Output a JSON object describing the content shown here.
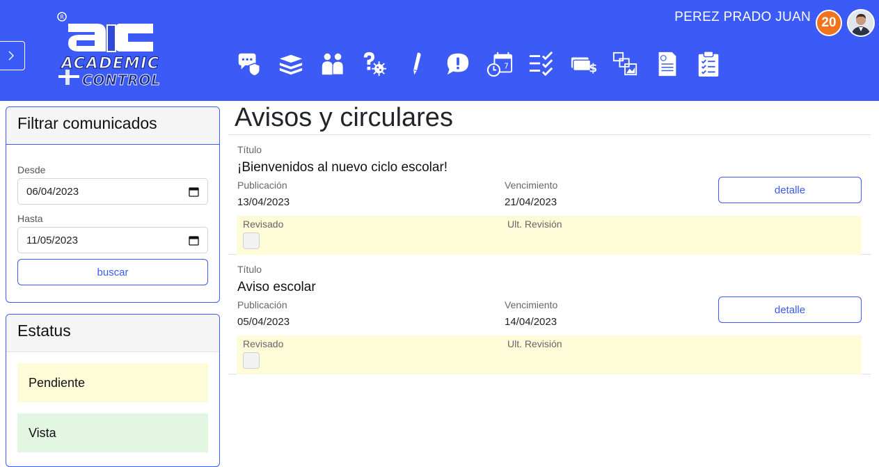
{
  "header": {
    "logo_text_top": "ACADEMIC",
    "logo_text_bottom": "CONTROL",
    "user_name": "PEREZ PRADO JUAN",
    "notification_count": "20",
    "accent_color": "#3b5af6",
    "nav_icons": [
      "chat-shield-icon",
      "books-icon",
      "users-icon",
      "question-virus-icon",
      "pencil-icon",
      "chat-alert-icon",
      "calendar-clock-icon",
      "checklist-icon",
      "payment-icon",
      "gallery-icon",
      "document-euro-icon",
      "clipboard-checklist-icon"
    ]
  },
  "filter": {
    "title": "Filtrar comunicados",
    "from_label": "Desde",
    "from_value": "06/04/2023",
    "to_label": "Hasta",
    "to_value": "11/05/2023",
    "search_label": "buscar"
  },
  "status": {
    "title": "Estatus",
    "items": [
      {
        "label": "Pendiente",
        "color": "#fefcd8"
      },
      {
        "label": "Vista",
        "color": "#e2f6e1"
      }
    ]
  },
  "main": {
    "title": "Avisos y circulares",
    "notices": [
      {
        "title_label": "Título",
        "title": "¡Bienvenidos al nuevo ciclo escolar!",
        "pub_label": "Publicación",
        "pub_date": "13/04/2023",
        "exp_label": "Vencimiento",
        "exp_date": "21/04/2023",
        "detail_label": "detalle",
        "reviewed_label": "Revisado",
        "last_review_label": "Ult. Revisión"
      },
      {
        "title_label": "Título",
        "title": "Aviso escolar",
        "pub_label": "Publicación",
        "pub_date": "05/04/2023",
        "exp_label": "Vencimiento",
        "exp_date": "14/04/2023",
        "detail_label": "detalle",
        "reviewed_label": "Revisado",
        "last_review_label": "Ult. Revisión"
      }
    ]
  }
}
